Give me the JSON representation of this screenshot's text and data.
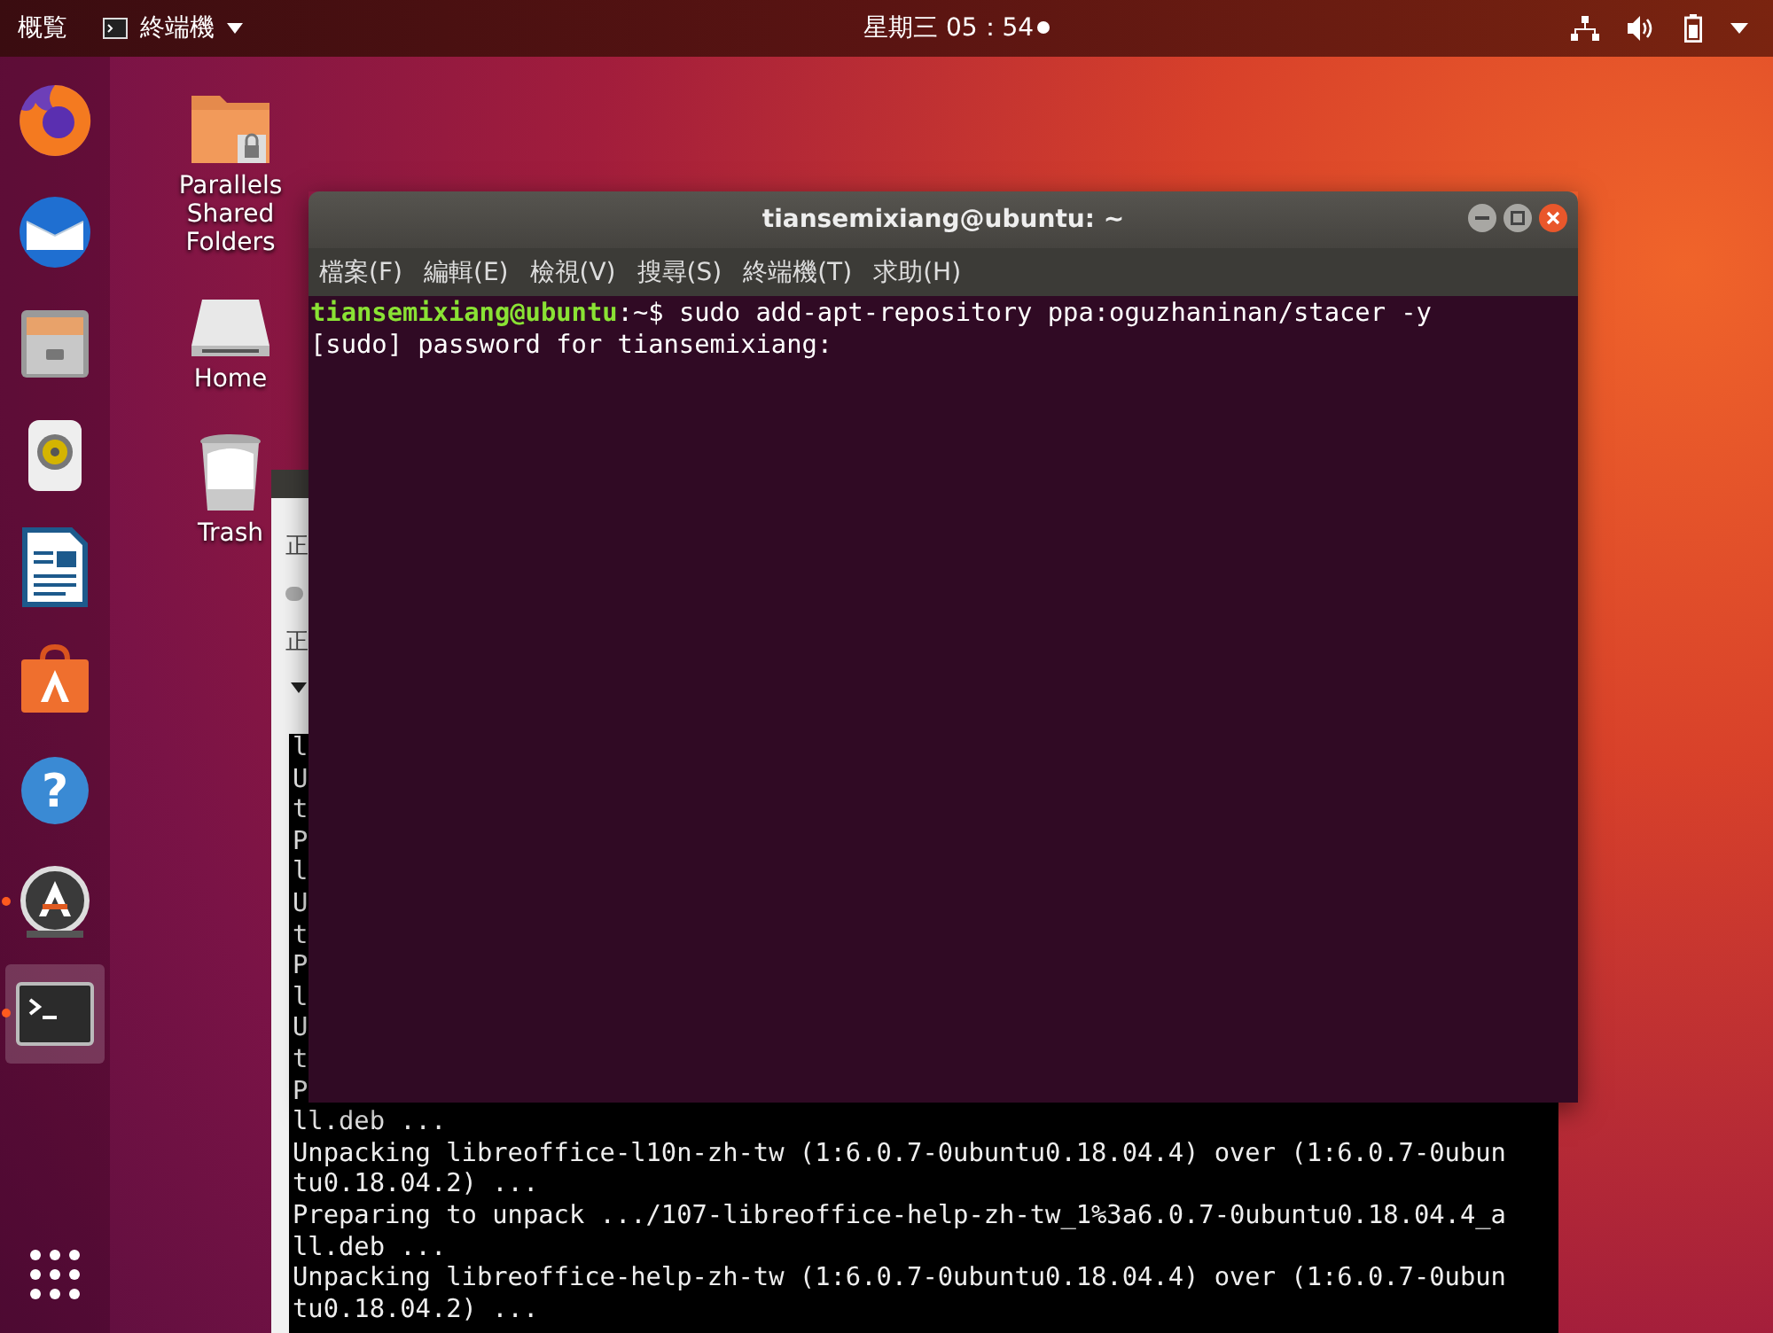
{
  "top_bar": {
    "activities": "概覧",
    "app_menu": "終端機",
    "clock": "星期三 05：54",
    "notification": true
  },
  "dock": [
    {
      "kind": "firefox",
      "running": false,
      "selected": false
    },
    {
      "kind": "mail",
      "running": false,
      "selected": false
    },
    {
      "kind": "files",
      "running": false,
      "selected": false
    },
    {
      "kind": "music",
      "running": false,
      "selected": false
    },
    {
      "kind": "writer",
      "running": false,
      "selected": false
    },
    {
      "kind": "store",
      "running": false,
      "selected": false
    },
    {
      "kind": "help",
      "glyph": "?",
      "running": false,
      "selected": false
    },
    {
      "kind": "updater",
      "running": true,
      "selected": false
    },
    {
      "kind": "terminal",
      "running": true,
      "selected": true
    }
  ],
  "desktop_icons": [
    {
      "kind": "shared-folder",
      "label": "Parallels Shared Folders"
    },
    {
      "kind": "drive",
      "label": "Home"
    },
    {
      "kind": "trash",
      "label": "Trash"
    }
  ],
  "background_window": {
    "status_1": "正",
    "status_2": "正",
    "expanded": true,
    "lines": [
      "l",
      "U",
      "t",
      "P",
      "l",
      "U",
      "t",
      "P",
      "l",
      "U",
      "t",
      "P",
      "ll.deb ...",
      "Unpacking libreoffice-l10n-zh-tw (1:6.0.7-0ubuntu0.18.04.4) over (1:6.0.7-0ubun",
      "tu0.18.04.2) ...",
      "Preparing to unpack .../107-libreoffice-help-zh-tw_1%3a6.0.7-0ubuntu0.18.04.4_a",
      "ll.deb ...",
      "Unpacking libreoffice-help-zh-tw (1:6.0.7-0ubuntu0.18.04.4) over (1:6.0.7-0ubun",
      "tu0.18.04.2) ..."
    ]
  },
  "terminal": {
    "title": "tiansemixiang@ubuntu: ~",
    "menu": [
      "檔案(F)",
      "編輯(E)",
      "檢視(V)",
      "搜尋(S)",
      "終端機(T)",
      "求助(H)"
    ],
    "prompt_user": "tiansemixiang@ubuntu",
    "prompt_path": ":~$",
    "command": " sudo add-apt-repository ppa:oguzhaninan/stacer -y",
    "output": [
      "[sudo] password for tiansemixiang:"
    ]
  }
}
